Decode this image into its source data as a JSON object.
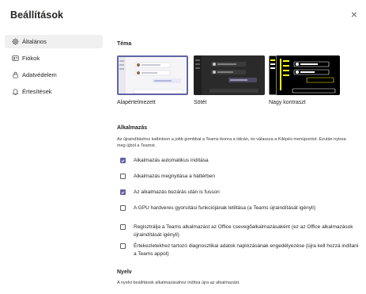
{
  "dialog": {
    "title": "Beállítások",
    "close_glyph": "×"
  },
  "sidebar": {
    "items": [
      {
        "label": "Általános",
        "icon": "gear-icon",
        "active": true
      },
      {
        "label": "Fiókok",
        "icon": "accounts-icon",
        "active": false
      },
      {
        "label": "Adatvédelem",
        "icon": "lock-icon",
        "active": false
      },
      {
        "label": "Értesítések",
        "icon": "bell-icon",
        "active": false
      }
    ]
  },
  "theme": {
    "heading": "Téma",
    "options": [
      {
        "name": "Alapértelmezett",
        "selected": true
      },
      {
        "name": "Sötét",
        "selected": false
      },
      {
        "name": "Nagy kontraszt",
        "selected": false
      }
    ]
  },
  "application": {
    "heading": "Alkalmazás",
    "description": "Az újraindításhoz kattintson a jobb gombbal a Teams ikonra a tálcán, és válassza a Kilépés menüpontot. Ezután nyissa meg újból a Teamst.",
    "options": [
      {
        "label": "Alkalmazás automatikus indítása",
        "checked": true
      },
      {
        "label": "Alkalmazás megnyitása a háttérben",
        "checked": false
      },
      {
        "label": "Az alkalmazás bezárás után is fusson",
        "checked": true
      },
      {
        "label": "A GPU hardveres gyorsítási funkciójának letiltása (a Teams újraindítását igényli)",
        "checked": false
      },
      {
        "label": "Regisztrálja a Teams alkalmazást az Office csevegőalkalmazásaként (ez az Office alkalmazások újraindítását igényli)",
        "checked": false
      },
      {
        "label": "Értekezletekhez tartozó diagnosztikai adatok naplózásának engedélyezése (újra kell hozzá indítani a Teams appot)",
        "checked": false
      }
    ]
  },
  "language": {
    "heading": "Nyelv",
    "description": "A nyelvi beállítások alkalmazásához indítsa újra az alkalmazást."
  },
  "colors": {
    "accent": "#6264a7",
    "text": "#252423",
    "dark_theme_bg": "#2a2a2a",
    "hc_theme_bg": "#000000"
  }
}
